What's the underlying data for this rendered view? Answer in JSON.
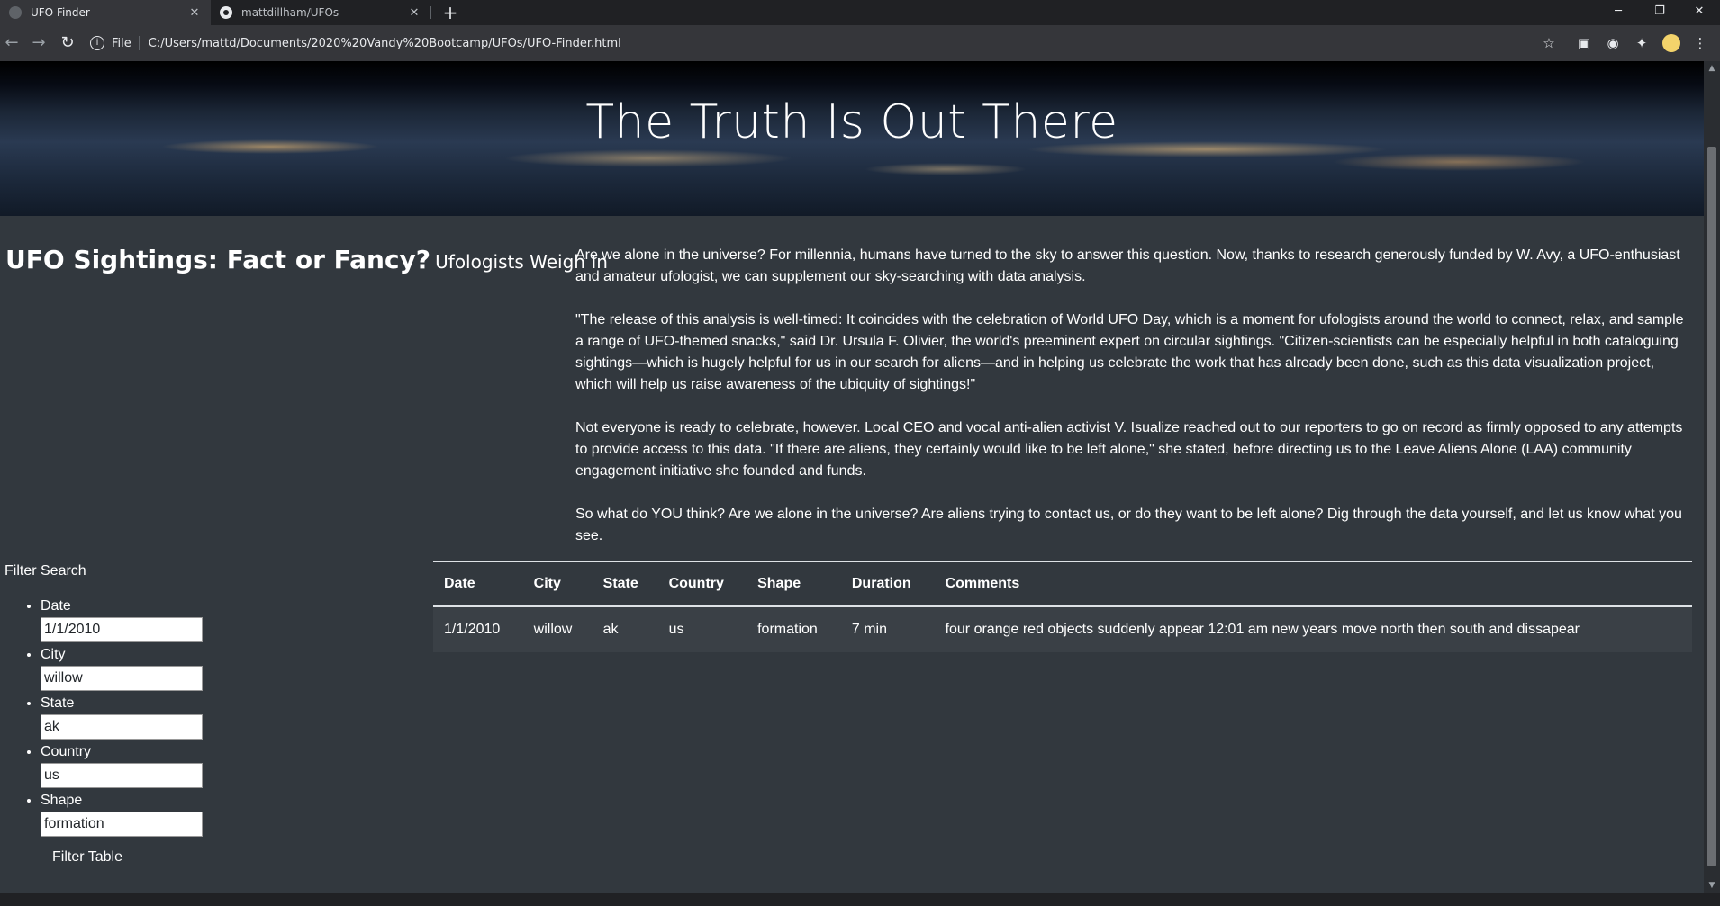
{
  "browser": {
    "tabs": [
      {
        "title": "UFO Finder",
        "active": true
      },
      {
        "title": "mattdillham/UFOs",
        "active": false
      }
    ],
    "new_tab": "+",
    "address": {
      "scheme": "File",
      "url": "C:/Users/mattd/Documents/2020%20Vandy%20Bootcamp/UFOs/UFO-Finder.html"
    }
  },
  "hero": {
    "title": "The Truth Is Out There"
  },
  "headline": {
    "main": "UFO Sightings: Fact or Fancy?",
    "sub": "Ufologists Weigh In"
  },
  "article": {
    "paragraphs": [
      "Are we alone in the universe? For millennia, humans have turned to the sky to answer this question. Now, thanks to research generously funded by W. Avy, a UFO-enthusiast and amateur ufologist, we can supplement our sky-searching with data analysis.",
      "\"The release of this analysis is well-timed: It coincides with the celebration of World UFO Day, which is a moment for ufologists around the world to connect, relax, and sample a range of UFO-themed snacks,\" said Dr. Ursula F. Olivier, the world's preeminent expert on circular sightings. \"Citizen-scientists can be especially helpful in both cataloguing sightings—which is hugely helpful for us in our search for aliens—and in helping us celebrate the work that has already been done, such as this data visualization project, which will help us raise awareness of the ubiquity of sightings!\"",
      "Not everyone is ready to celebrate, however. Local CEO and vocal anti-alien activist V. Isualize reached out to our reporters to go on record as firmly opposed to any attempts to provide access to this data. \"If there are aliens, they certainly would like to be left alone,\" she stated, before directing us to the Leave Aliens Alone (LAA) community engagement initiative she founded and funds.",
      "So what do YOU think? Are we alone in the universe? Are aliens trying to contact us, or do they want to be left alone? Dig through the data yourself, and let us know what you see."
    ]
  },
  "filters": {
    "title": "Filter Search",
    "fields": [
      {
        "label": "Date",
        "value": "1/1/2010"
      },
      {
        "label": "City",
        "value": "willow"
      },
      {
        "label": "State",
        "value": "ak"
      },
      {
        "label": "Country",
        "value": "us"
      },
      {
        "label": "Shape",
        "value": "formation"
      }
    ],
    "button": "Filter Table"
  },
  "table": {
    "headers": [
      "Date",
      "City",
      "State",
      "Country",
      "Shape",
      "Duration",
      "Comments"
    ],
    "rows": [
      [
        "1/1/2010",
        "willow",
        "ak",
        "us",
        "formation",
        "7 min",
        "four orange red objects suddenly appear 12:01 am new years move north then south and dissapear"
      ]
    ]
  }
}
